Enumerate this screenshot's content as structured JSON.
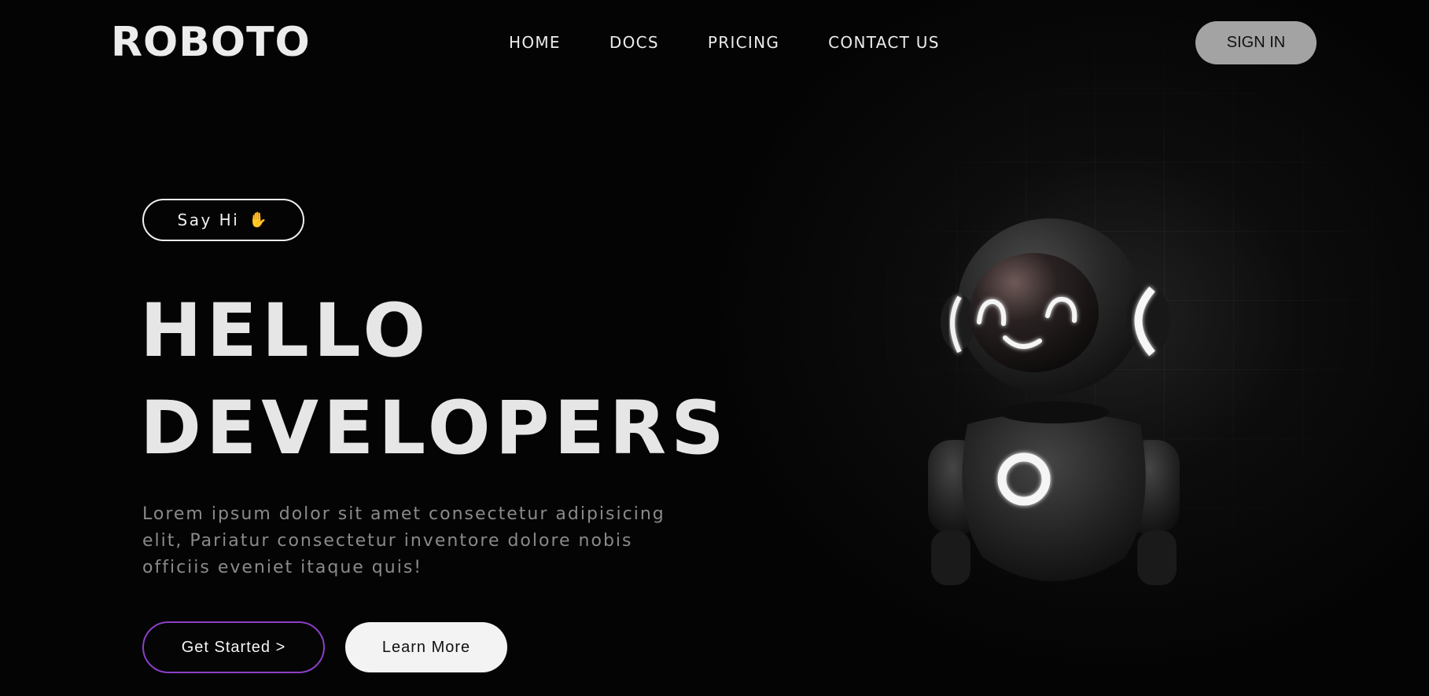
{
  "header": {
    "logo": "ROBOTO",
    "nav": [
      "HOME",
      "DOCS",
      "PRICING",
      "CONTACT US"
    ],
    "sign_in_label": "SIGN IN"
  },
  "hero": {
    "badge_label": "Say Hi",
    "badge_icon": "waving-hand-icon",
    "title_line1": "HELLO",
    "title_line2": "DEVELOPERS",
    "description": "Lorem ipsum dolor sit amet consectetur adipisicing elit, Pariatur consectetur inventore dolore nobis officiis eveniet itaque quis!",
    "primary_button": "Get Started >",
    "secondary_button": "Learn More"
  },
  "colors": {
    "background": "#040404",
    "accent_border": "#8b3fc7",
    "sign_in_bg": "#a3a3a3",
    "learn_more_bg": "#f3f3f3"
  }
}
